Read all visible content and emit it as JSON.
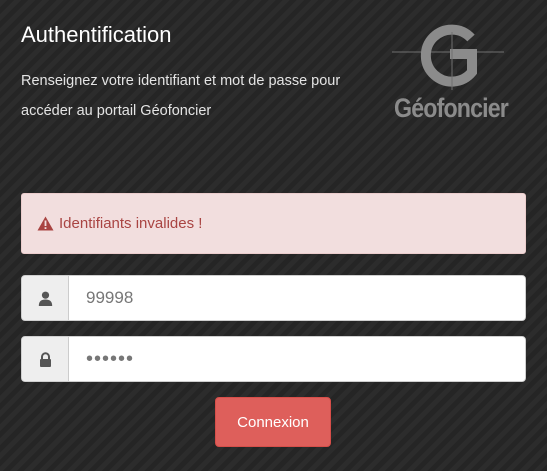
{
  "header": {
    "title": "Authentification",
    "subtitle": "Renseignez votre identifiant et mot de passe pour accéder au portail Géofoncier"
  },
  "logo": {
    "text": "Géofoncier",
    "icon": "geofoncier-g-logo",
    "color": "#8b8b8b"
  },
  "alert": {
    "icon": "warning-triangle-icon",
    "message": "Identifiants invalides !",
    "text_color": "#a94442",
    "background": "#f2dede"
  },
  "form": {
    "username": {
      "icon": "user-icon",
      "value": "99998"
    },
    "password": {
      "icon": "lock-icon",
      "value": "••••••"
    },
    "submit_label": "Connexion",
    "submit_color": "#de5f5b"
  }
}
